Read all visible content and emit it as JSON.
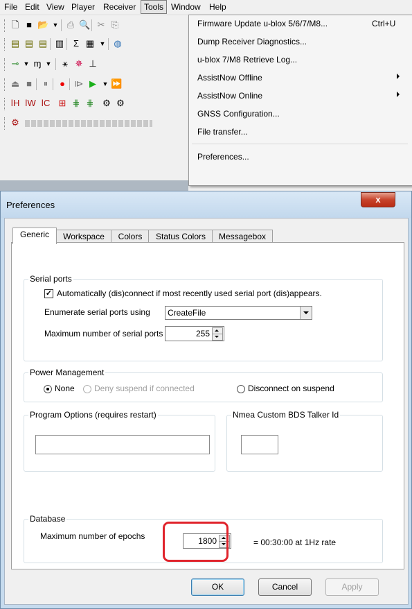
{
  "menubar": {
    "items": [
      "File",
      "Edit",
      "View",
      "Player",
      "Receiver",
      "Tools",
      "Window",
      "Help"
    ],
    "active": "Tools"
  },
  "tools_menu": {
    "items": [
      {
        "label": "Firmware Update u-blox 5/6/7/M8...",
        "shortcut": "Ctrl+U",
        "submenu": false
      },
      {
        "label": "Dump Receiver Diagnostics...",
        "shortcut": "",
        "submenu": false
      },
      {
        "label": "u-blox 7/M8 Retrieve Log...",
        "shortcut": "",
        "submenu": false
      },
      {
        "label": "AssistNow Offline",
        "shortcut": "",
        "submenu": true
      },
      {
        "label": "AssistNow Online",
        "shortcut": "",
        "submenu": true
      },
      {
        "label": "GNSS Configuration...",
        "shortcut": "",
        "submenu": false
      },
      {
        "label": "File transfer...",
        "shortcut": "",
        "submenu": false
      },
      {
        "label": "Preferences...",
        "shortcut": "",
        "submenu": false
      }
    ]
  },
  "toolbar_icons": {
    "row1": [
      "new-icon",
      "save-icon",
      "open-icon",
      "print-icon",
      "print-preview-icon",
      "cut-icon",
      "copy-icon"
    ],
    "row2": [
      "doc-a-icon",
      "doc-b-icon",
      "doc-c-icon",
      "view-icon",
      "sum-icon",
      "table-icon",
      "globe-icon"
    ],
    "row3": [
      "connect-icon",
      "baud-icon",
      "satellite-icon",
      "compass-icon",
      "antenna-icon"
    ],
    "row4": [
      "eject-icon",
      "stop-icon",
      "pause-icon",
      "record-icon",
      "step-icon",
      "play-icon",
      "forward-icon"
    ],
    "row5": [
      "message-h-icon",
      "message-w-icon",
      "message-c-icon",
      "poll-icon",
      "config-a-icon",
      "config-b-icon",
      "gear-a-icon",
      "gear-b-icon"
    ],
    "row6": [
      "status-icon"
    ]
  },
  "dialog": {
    "title": "Preferences",
    "close_label": "x",
    "tabs": [
      "Generic",
      "Workspace",
      "Colors",
      "Status Colors",
      "Messagebox"
    ],
    "active_tab": "Generic",
    "serial_ports": {
      "group_title": "Serial ports",
      "auto_connect_label": "Automatically (dis)connect if most recently used serial port (dis)appears.",
      "auto_connect_checked": true,
      "enumerate_label": "Enumerate serial ports using",
      "enumerate_value": "CreateFile",
      "max_ports_label": "Maximum number of serial ports",
      "max_ports_value": "255"
    },
    "power": {
      "group_title": "Power Management",
      "options": [
        "None",
        "Deny suspend if connected",
        "Disconnect on suspend"
      ],
      "selected": "None"
    },
    "program_options": {
      "group_title": "Program Options (requires restart)",
      "value": ""
    },
    "nmea": {
      "group_title": "Nmea Custom BDS Talker Id",
      "value": ""
    },
    "database": {
      "group_title": "Database",
      "max_epochs_label": "Maximum number of epochs",
      "max_epochs_value": "1800",
      "rate_text": "= 00:30:00 at 1Hz rate"
    },
    "buttons": {
      "ok": "OK",
      "cancel": "Cancel",
      "apply": "Apply"
    },
    "highlight_color": "#e0232b"
  }
}
